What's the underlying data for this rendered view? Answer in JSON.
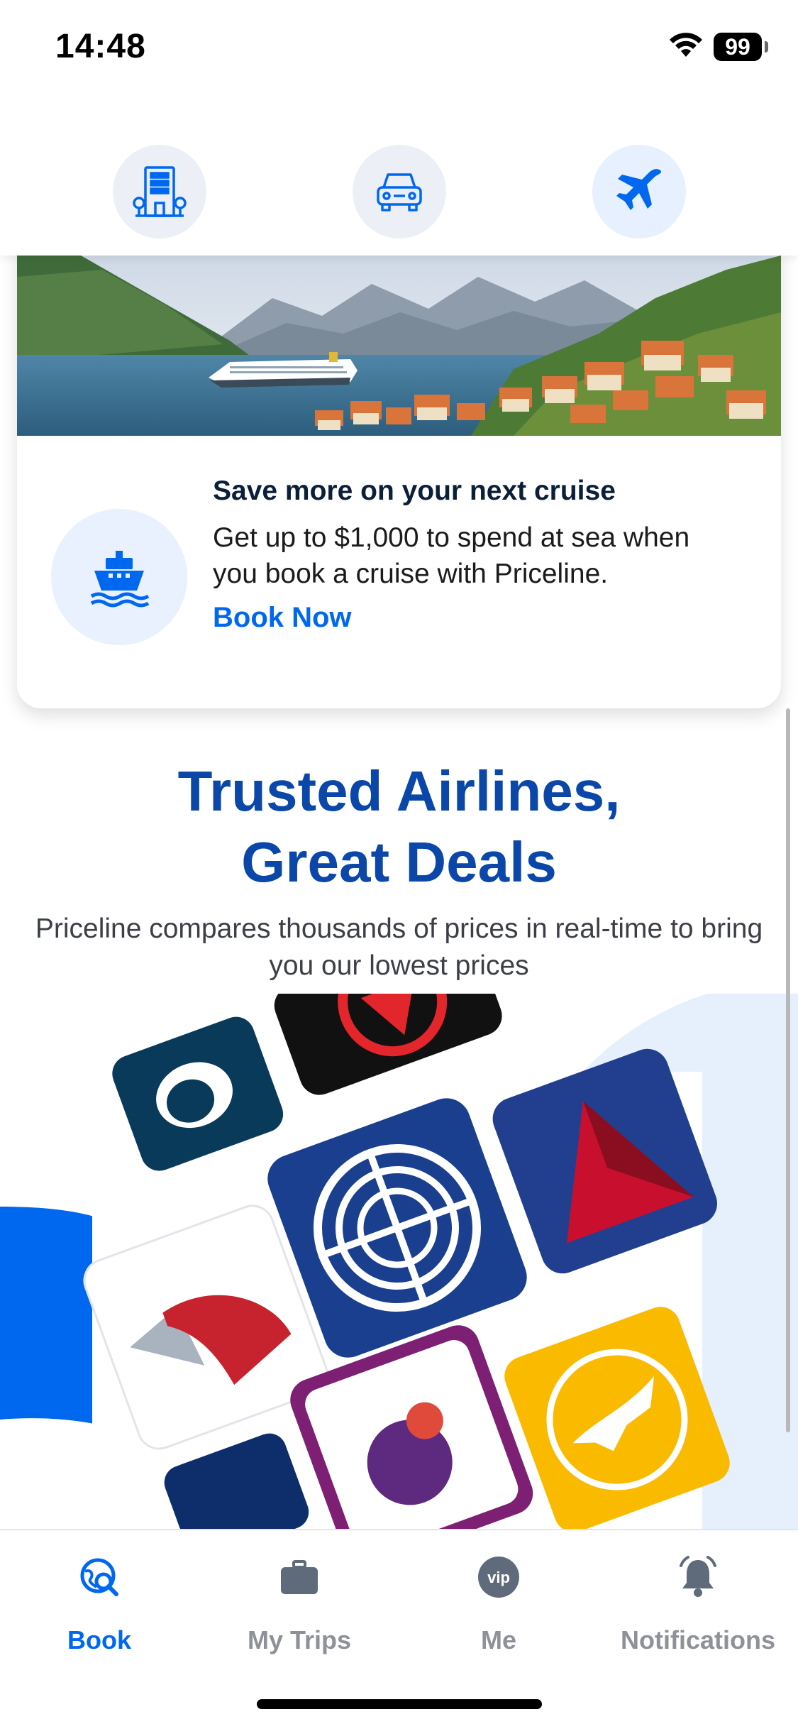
{
  "status_bar": {
    "time": "14:48",
    "battery": "99"
  },
  "product_selector": {
    "items": [
      {
        "icon": "hotel-icon",
        "active": false
      },
      {
        "icon": "car-icon",
        "active": false
      },
      {
        "icon": "flight-icon",
        "active": true
      }
    ]
  },
  "promo": {
    "title": "Save more on your next cruise",
    "body": "Get up to $1,000 to spend at sea when you book a cruise with Priceline.",
    "link": "Book Now",
    "icon": "cruise-ship-icon"
  },
  "trusted": {
    "title_line1": "Trusted Airlines,",
    "title_line2": "Great Deals",
    "subtitle": "Priceline compares thousands of prices in real-time to bring you our lowest prices"
  },
  "tabs": [
    {
      "label": "Book",
      "icon": "book-search-icon",
      "active": true
    },
    {
      "label": "My Trips",
      "icon": "briefcase-icon",
      "active": false
    },
    {
      "label": "Me",
      "icon": "vip-icon",
      "active": false
    },
    {
      "label": "Notifications",
      "icon": "bell-icon",
      "active": false
    }
  ],
  "colors": {
    "brand_blue": "#0068ef",
    "title_blue": "#0a47a9",
    "inactive_tab": "#8e9198"
  }
}
